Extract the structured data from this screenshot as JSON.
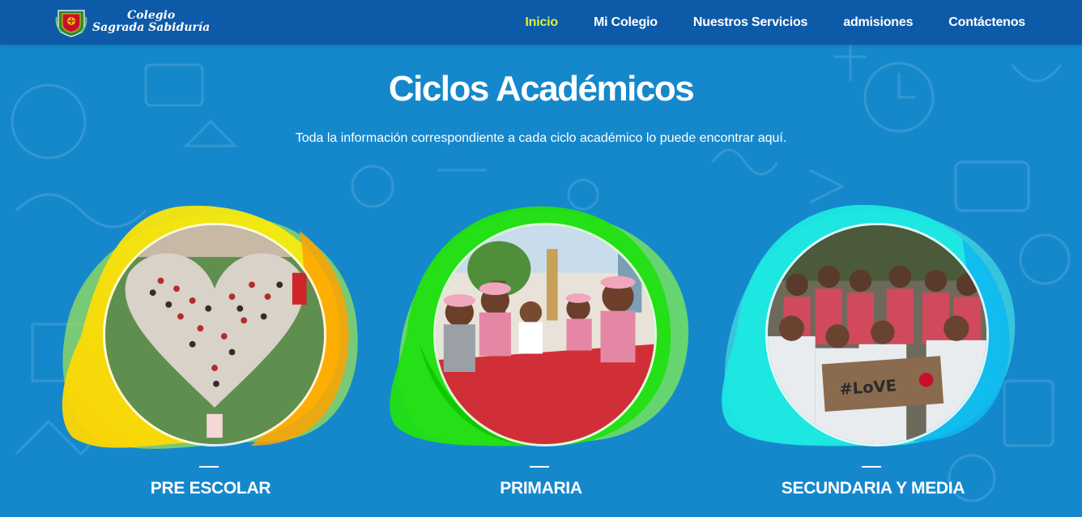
{
  "brand": {
    "line1": "Colegio",
    "line2": "Sagrada Sabiduría"
  },
  "nav": {
    "items": [
      {
        "label": "Inicio",
        "active": true
      },
      {
        "label": "Mi Colegio",
        "active": false
      },
      {
        "label": "Nuestros Servicios",
        "active": false
      },
      {
        "label": "admisiones",
        "active": false
      },
      {
        "label": "Contáctenos",
        "active": false
      }
    ]
  },
  "hero": {
    "title": "Ciclos Académicos",
    "subtitle": "Toda la información correspondiente a cada ciclo académico lo puede encontrar aquí."
  },
  "cycles": [
    {
      "title": "PRE ESCOLAR",
      "blob_colors": [
        "#f6e300",
        "#ffb800",
        "#9be05a"
      ]
    },
    {
      "title": "PRIMARIA",
      "blob_colors": [
        "#39e51a",
        "#17d400",
        "#7be95a"
      ]
    },
    {
      "title": "SECUNDARIA Y MEDIA",
      "blob_colors": [
        "#1de8e0",
        "#12c6f2",
        "#3fd5e0"
      ]
    }
  ],
  "colors": {
    "background": "#1588cc",
    "navbar": "#0d5aa8",
    "nav_active": "#d8f23a"
  }
}
